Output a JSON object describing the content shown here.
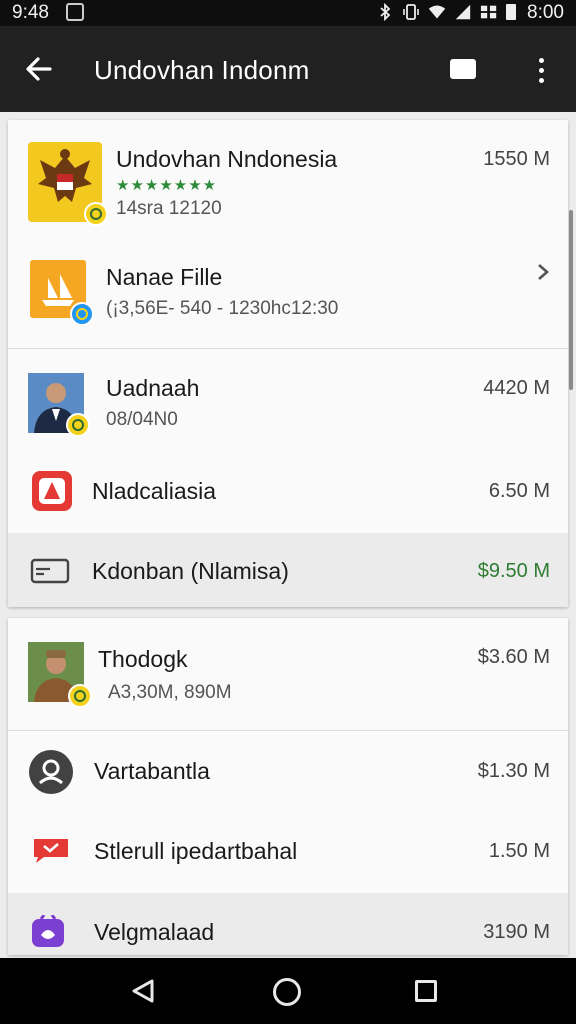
{
  "status_bar": {
    "time_left": "9:48",
    "time_right": "8:00"
  },
  "app_bar": {
    "title": "Undovhan Indonm"
  },
  "card1": {
    "items": [
      {
        "title": "Undovhan Nndonesia",
        "rating_stars": "★★★★★★★",
        "subtitle": "14sra 12120",
        "size": "1550 M"
      },
      {
        "title": "Nanae Fille",
        "subtitle": "(¡3,56E- 540 - 1230hc12:30"
      },
      {
        "title": "Uadnaah",
        "subtitle": "08/04N0",
        "size": "4420 M"
      },
      {
        "title": "Nladcaliasia",
        "size": "6.50 M"
      },
      {
        "title": "Kdonban (Nlamisa)",
        "size": "$9.50 M",
        "size_color": "#2e7d32"
      }
    ]
  },
  "card2": {
    "items": [
      {
        "title": "Thodogk",
        "subtitle": "A3,30M, 890M",
        "size": "$3.60 M"
      },
      {
        "title": "Vartabantla",
        "size": "$1.30 M"
      },
      {
        "title": "Stlerull ipedartbahal",
        "size": "1.50 M"
      },
      {
        "title": "Velgmalaad",
        "size": "3190 M"
      }
    ]
  }
}
